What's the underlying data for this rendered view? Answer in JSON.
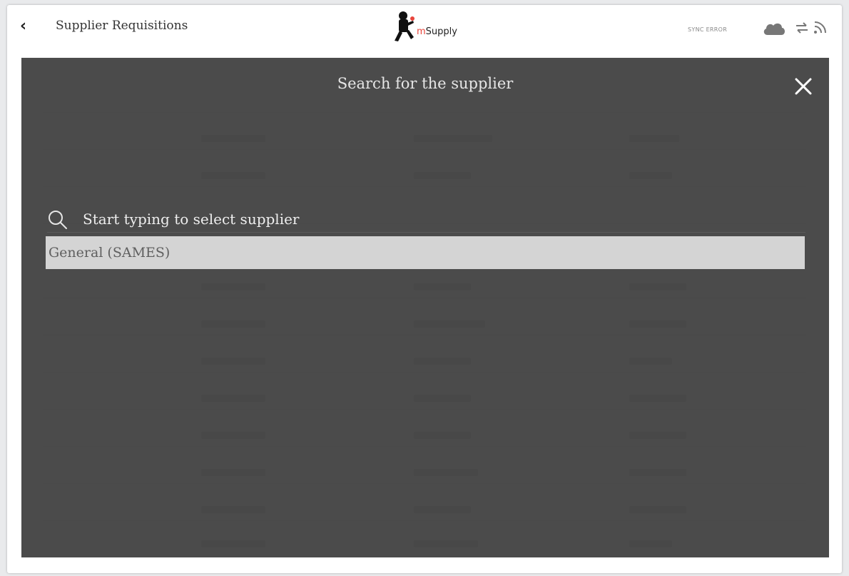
{
  "header": {
    "back_icon": "chevron-left-icon",
    "title": "Supplier Requisitions",
    "logo_text_prefix": "m",
    "logo_text": "Supply",
    "sync_status": "SYNC ERROR",
    "status_icons": [
      "cloud-icon",
      "sync-arrows-icon",
      "feed-icon"
    ]
  },
  "modal": {
    "title": "Search for the supplier",
    "close_icon": "close-icon",
    "search": {
      "placeholder": "Start typing to select supplier",
      "value": ""
    },
    "results": [
      {
        "label": "General (SAMES)"
      }
    ]
  },
  "colors": {
    "overlay": "#3c3c3c",
    "result_highlight": "#d4d4d4",
    "logo_accent": "#e8453c"
  }
}
